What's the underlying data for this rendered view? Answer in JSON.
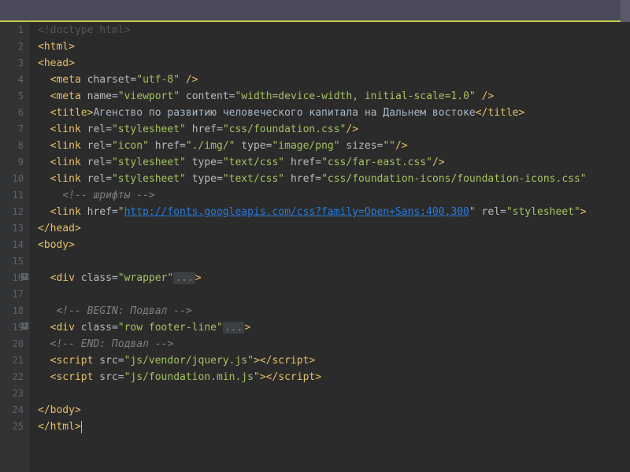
{
  "lines": [
    {
      "n": "1",
      "fold": false,
      "tokens": [
        {
          "t": "cut-top",
          "v": "<!doctype html>"
        }
      ]
    },
    {
      "n": "2",
      "fold": false,
      "tokens": [
        {
          "t": "tag-bracket",
          "v": "<"
        },
        {
          "t": "tag-name",
          "v": "html"
        },
        {
          "t": "tag-bracket",
          "v": ">"
        }
      ]
    },
    {
      "n": "3",
      "fold": false,
      "tokens": [
        {
          "t": "tag-bracket",
          "v": "<"
        },
        {
          "t": "tag-name",
          "v": "head"
        },
        {
          "t": "tag-bracket",
          "v": ">"
        }
      ]
    },
    {
      "n": "4",
      "fold": false,
      "tokens": [
        {
          "t": "plain",
          "v": "  "
        },
        {
          "t": "tag-bracket",
          "v": "<"
        },
        {
          "t": "tag-name",
          "v": "meta"
        },
        {
          "t": "plain",
          "v": " "
        },
        {
          "t": "attr-name",
          "v": "charset"
        },
        {
          "t": "plain",
          "v": "="
        },
        {
          "t": "attr-val",
          "v": "\"utf-8\""
        },
        {
          "t": "plain",
          "v": " "
        },
        {
          "t": "tag-bracket",
          "v": "/>"
        }
      ]
    },
    {
      "n": "5",
      "fold": false,
      "tokens": [
        {
          "t": "plain",
          "v": "  "
        },
        {
          "t": "tag-bracket",
          "v": "<"
        },
        {
          "t": "tag-name",
          "v": "meta"
        },
        {
          "t": "plain",
          "v": " "
        },
        {
          "t": "attr-name",
          "v": "name"
        },
        {
          "t": "plain",
          "v": "="
        },
        {
          "t": "attr-val",
          "v": "\"viewport\""
        },
        {
          "t": "plain",
          "v": " "
        },
        {
          "t": "attr-name",
          "v": "content"
        },
        {
          "t": "plain",
          "v": "="
        },
        {
          "t": "attr-val",
          "v": "\"width=device-width, initial-scale=1.0\""
        },
        {
          "t": "plain",
          "v": " "
        },
        {
          "t": "tag-bracket",
          "v": "/>"
        }
      ]
    },
    {
      "n": "6",
      "fold": false,
      "tokens": [
        {
          "t": "plain",
          "v": "  "
        },
        {
          "t": "tag-bracket",
          "v": "<"
        },
        {
          "t": "tag-name",
          "v": "title"
        },
        {
          "t": "tag-bracket",
          "v": ">"
        },
        {
          "t": "text-content",
          "v": "Агенство по развитию человеческого капитала на Дальнем востоке"
        },
        {
          "t": "tag-bracket",
          "v": "</"
        },
        {
          "t": "tag-name",
          "v": "title"
        },
        {
          "t": "tag-bracket",
          "v": ">"
        }
      ]
    },
    {
      "n": "7",
      "fold": false,
      "tokens": [
        {
          "t": "plain",
          "v": "  "
        },
        {
          "t": "tag-bracket",
          "v": "<"
        },
        {
          "t": "tag-name",
          "v": "link"
        },
        {
          "t": "plain",
          "v": " "
        },
        {
          "t": "attr-name",
          "v": "rel"
        },
        {
          "t": "plain",
          "v": "="
        },
        {
          "t": "attr-val",
          "v": "\"stylesheet\""
        },
        {
          "t": "plain",
          "v": " "
        },
        {
          "t": "attr-name",
          "v": "href"
        },
        {
          "t": "plain",
          "v": "="
        },
        {
          "t": "attr-val",
          "v": "\"css/foundation.css\""
        },
        {
          "t": "tag-bracket",
          "v": "/>"
        }
      ]
    },
    {
      "n": "8",
      "fold": false,
      "tokens": [
        {
          "t": "plain",
          "v": "  "
        },
        {
          "t": "tag-bracket",
          "v": "<"
        },
        {
          "t": "tag-name",
          "v": "link"
        },
        {
          "t": "plain",
          "v": " "
        },
        {
          "t": "attr-name",
          "v": "rel"
        },
        {
          "t": "plain",
          "v": "="
        },
        {
          "t": "attr-val",
          "v": "\"icon\""
        },
        {
          "t": "plain",
          "v": " "
        },
        {
          "t": "attr-name",
          "v": "href"
        },
        {
          "t": "plain",
          "v": "="
        },
        {
          "t": "attr-val",
          "v": "\"./img/\""
        },
        {
          "t": "plain",
          "v": " "
        },
        {
          "t": "attr-name",
          "v": "type"
        },
        {
          "t": "plain",
          "v": "="
        },
        {
          "t": "attr-val",
          "v": "\"image/png\""
        },
        {
          "t": "plain",
          "v": " "
        },
        {
          "t": "attr-name",
          "v": "sizes"
        },
        {
          "t": "plain",
          "v": "="
        },
        {
          "t": "attr-val",
          "v": "\"\""
        },
        {
          "t": "tag-bracket",
          "v": "/>"
        }
      ]
    },
    {
      "n": "9",
      "fold": false,
      "tokens": [
        {
          "t": "plain",
          "v": "  "
        },
        {
          "t": "tag-bracket",
          "v": "<"
        },
        {
          "t": "tag-name",
          "v": "link"
        },
        {
          "t": "plain",
          "v": " "
        },
        {
          "t": "attr-name",
          "v": "rel"
        },
        {
          "t": "plain",
          "v": "="
        },
        {
          "t": "attr-val",
          "v": "\"stylesheet\""
        },
        {
          "t": "plain",
          "v": " "
        },
        {
          "t": "attr-name",
          "v": "type"
        },
        {
          "t": "plain",
          "v": "="
        },
        {
          "t": "attr-val",
          "v": "\"text/css\""
        },
        {
          "t": "plain",
          "v": " "
        },
        {
          "t": "attr-name",
          "v": "href"
        },
        {
          "t": "plain",
          "v": "="
        },
        {
          "t": "attr-val",
          "v": "\"css/far-east.css\""
        },
        {
          "t": "tag-bracket",
          "v": "/>"
        }
      ]
    },
    {
      "n": "10",
      "fold": false,
      "tokens": [
        {
          "t": "plain",
          "v": "  "
        },
        {
          "t": "tag-bracket",
          "v": "<"
        },
        {
          "t": "tag-name",
          "v": "link"
        },
        {
          "t": "plain",
          "v": " "
        },
        {
          "t": "attr-name",
          "v": "rel"
        },
        {
          "t": "plain",
          "v": "="
        },
        {
          "t": "attr-val",
          "v": "\"stylesheet\""
        },
        {
          "t": "plain",
          "v": " "
        },
        {
          "t": "attr-name",
          "v": "type"
        },
        {
          "t": "plain",
          "v": "="
        },
        {
          "t": "attr-val",
          "v": "\"text/css\""
        },
        {
          "t": "plain",
          "v": " "
        },
        {
          "t": "attr-name",
          "v": "href"
        },
        {
          "t": "plain",
          "v": "="
        },
        {
          "t": "attr-val",
          "v": "\"css/foundation-icons/foundation-icons.css\""
        }
      ]
    },
    {
      "n": "11",
      "fold": false,
      "tokens": [
        {
          "t": "plain",
          "v": "    "
        },
        {
          "t": "comment",
          "v": "<!-- шрифты -->"
        }
      ]
    },
    {
      "n": "12",
      "fold": false,
      "tokens": [
        {
          "t": "plain",
          "v": "  "
        },
        {
          "t": "tag-bracket",
          "v": "<"
        },
        {
          "t": "tag-name",
          "v": "link"
        },
        {
          "t": "plain",
          "v": " "
        },
        {
          "t": "attr-name",
          "v": "href"
        },
        {
          "t": "plain",
          "v": "="
        },
        {
          "t": "attr-val",
          "v": "\""
        },
        {
          "t": "attr-val-link",
          "v": "http://fonts.googleapis.com/css?family=Open+Sans:400,300"
        },
        {
          "t": "attr-val",
          "v": "\""
        },
        {
          "t": "plain",
          "v": " "
        },
        {
          "t": "attr-name",
          "v": "rel"
        },
        {
          "t": "plain",
          "v": "="
        },
        {
          "t": "attr-val",
          "v": "\"stylesheet\""
        },
        {
          "t": "tag-bracket",
          "v": ">"
        }
      ]
    },
    {
      "n": "13",
      "fold": false,
      "tokens": [
        {
          "t": "tag-bracket",
          "v": "</"
        },
        {
          "t": "tag-name",
          "v": "head"
        },
        {
          "t": "tag-bracket",
          "v": ">"
        }
      ]
    },
    {
      "n": "14",
      "fold": false,
      "tokens": [
        {
          "t": "tag-bracket",
          "v": "<"
        },
        {
          "t": "tag-name",
          "v": "body"
        },
        {
          "t": "tag-bracket",
          "v": ">"
        }
      ]
    },
    {
      "n": "15",
      "fold": false,
      "tokens": []
    },
    {
      "n": "16",
      "fold": true,
      "tokens": [
        {
          "t": "plain",
          "v": "  "
        },
        {
          "t": "tag-bracket",
          "v": "<"
        },
        {
          "t": "tag-name",
          "v": "div"
        },
        {
          "t": "plain",
          "v": " "
        },
        {
          "t": "attr-name",
          "v": "class"
        },
        {
          "t": "plain",
          "v": "="
        },
        {
          "t": "attr-val",
          "v": "\"wrapper\""
        },
        {
          "t": "folded",
          "v": "..."
        },
        {
          "t": "tag-bracket",
          "v": ">"
        }
      ]
    },
    {
      "n": "17",
      "fold": false,
      "tokens": []
    },
    {
      "n": "18",
      "fold": false,
      "tokens": [
        {
          "t": "plain",
          "v": "   "
        },
        {
          "t": "comment",
          "v": "<!-- BEGIN: Подвал -->"
        }
      ]
    },
    {
      "n": "19",
      "fold": true,
      "tokens": [
        {
          "t": "plain",
          "v": "  "
        },
        {
          "t": "tag-bracket",
          "v": "<"
        },
        {
          "t": "tag-name",
          "v": "div"
        },
        {
          "t": "plain",
          "v": " "
        },
        {
          "t": "attr-name",
          "v": "class"
        },
        {
          "t": "plain",
          "v": "="
        },
        {
          "t": "attr-val",
          "v": "\"row footer-line\""
        },
        {
          "t": "folded",
          "v": "..."
        },
        {
          "t": "tag-bracket",
          "v": ">"
        }
      ]
    },
    {
      "n": "20",
      "fold": false,
      "tokens": [
        {
          "t": "plain",
          "v": "  "
        },
        {
          "t": "comment",
          "v": "<!-- END: Подвал -->"
        }
      ]
    },
    {
      "n": "21",
      "fold": false,
      "tokens": [
        {
          "t": "plain",
          "v": "  "
        },
        {
          "t": "tag-bracket",
          "v": "<"
        },
        {
          "t": "tag-name",
          "v": "script"
        },
        {
          "t": "plain",
          "v": " "
        },
        {
          "t": "attr-name",
          "v": "src"
        },
        {
          "t": "plain",
          "v": "="
        },
        {
          "t": "attr-val",
          "v": "\"js/vendor/jquery.js\""
        },
        {
          "t": "tag-bracket",
          "v": ">"
        },
        {
          "t": "tag-bracket",
          "v": "</"
        },
        {
          "t": "tag-name",
          "v": "script"
        },
        {
          "t": "tag-bracket",
          "v": ">"
        }
      ]
    },
    {
      "n": "22",
      "fold": false,
      "tokens": [
        {
          "t": "plain",
          "v": "  "
        },
        {
          "t": "tag-bracket",
          "v": "<"
        },
        {
          "t": "tag-name",
          "v": "script"
        },
        {
          "t": "plain",
          "v": " "
        },
        {
          "t": "attr-name",
          "v": "src"
        },
        {
          "t": "plain",
          "v": "="
        },
        {
          "t": "attr-val",
          "v": "\"js/foundation.min.js\""
        },
        {
          "t": "tag-bracket",
          "v": ">"
        },
        {
          "t": "tag-bracket",
          "v": "</"
        },
        {
          "t": "tag-name",
          "v": "script"
        },
        {
          "t": "tag-bracket",
          "v": ">"
        }
      ]
    },
    {
      "n": "23",
      "fold": false,
      "tokens": []
    },
    {
      "n": "24",
      "fold": false,
      "tokens": [
        {
          "t": "tag-bracket",
          "v": "</"
        },
        {
          "t": "tag-name",
          "v": "body"
        },
        {
          "t": "tag-bracket",
          "v": ">"
        }
      ]
    },
    {
      "n": "25",
      "fold": false,
      "tokens": [
        {
          "t": "tag-bracket",
          "v": "</"
        },
        {
          "t": "tag-name",
          "v": "html"
        },
        {
          "t": "tag-bracket",
          "v": ">"
        },
        {
          "t": "cursor",
          "v": ""
        }
      ],
      "cursor": true
    }
  ],
  "fold_plus": "+"
}
